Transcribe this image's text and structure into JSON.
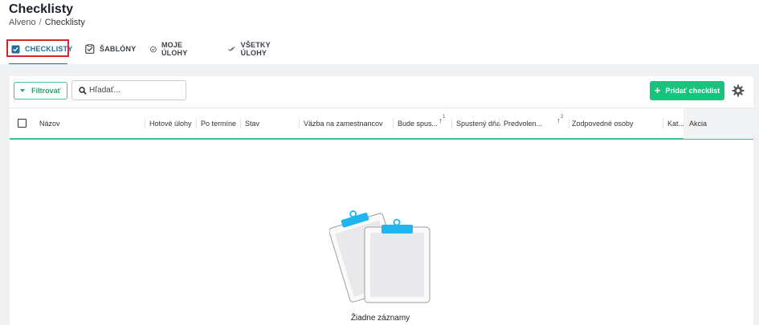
{
  "header": {
    "title": "Checklisty",
    "breadcrumb": {
      "root": "Alveno",
      "separator": "/",
      "current": "Checklisty"
    }
  },
  "tabs": [
    {
      "label": "CHECKLISTY",
      "icon": "clipboard-check-icon",
      "active": true
    },
    {
      "label": "ŠABLÓNY",
      "icon": "checkbox-icon",
      "active": false
    },
    {
      "label": "MOJE ÚLOHY",
      "icon": "circle-check-icon",
      "active": false
    },
    {
      "label": "VŠETKY ÚLOHY",
      "icon": "double-check-icon",
      "active": false
    }
  ],
  "toolbar": {
    "filter_label": "Filtrovať",
    "search_placeholder": "Hľadať...",
    "add_label": "Pridať checklist"
  },
  "table": {
    "columns": [
      {
        "label": "Názov"
      },
      {
        "label": "Hotové úlohy"
      },
      {
        "label": "Po termíne"
      },
      {
        "label": "Stav"
      },
      {
        "label": "Väzba na zamestnancov"
      },
      {
        "label": "Bude spus...",
        "sort_order": "1"
      },
      {
        "label": "Spustený dňa"
      },
      {
        "label": "Predvolen...",
        "sort_order": "2"
      },
      {
        "label": "Zodpovedné osoby"
      },
      {
        "label": "Kat..."
      }
    ],
    "action_column": "Akcia",
    "empty_text": "Žiadne záznamy"
  },
  "colors": {
    "accent_green": "#19c37d",
    "active_tab_blue": "#1f6f9f",
    "highlight_red": "#d9262a",
    "clip_blue": "#1fb6ef"
  }
}
